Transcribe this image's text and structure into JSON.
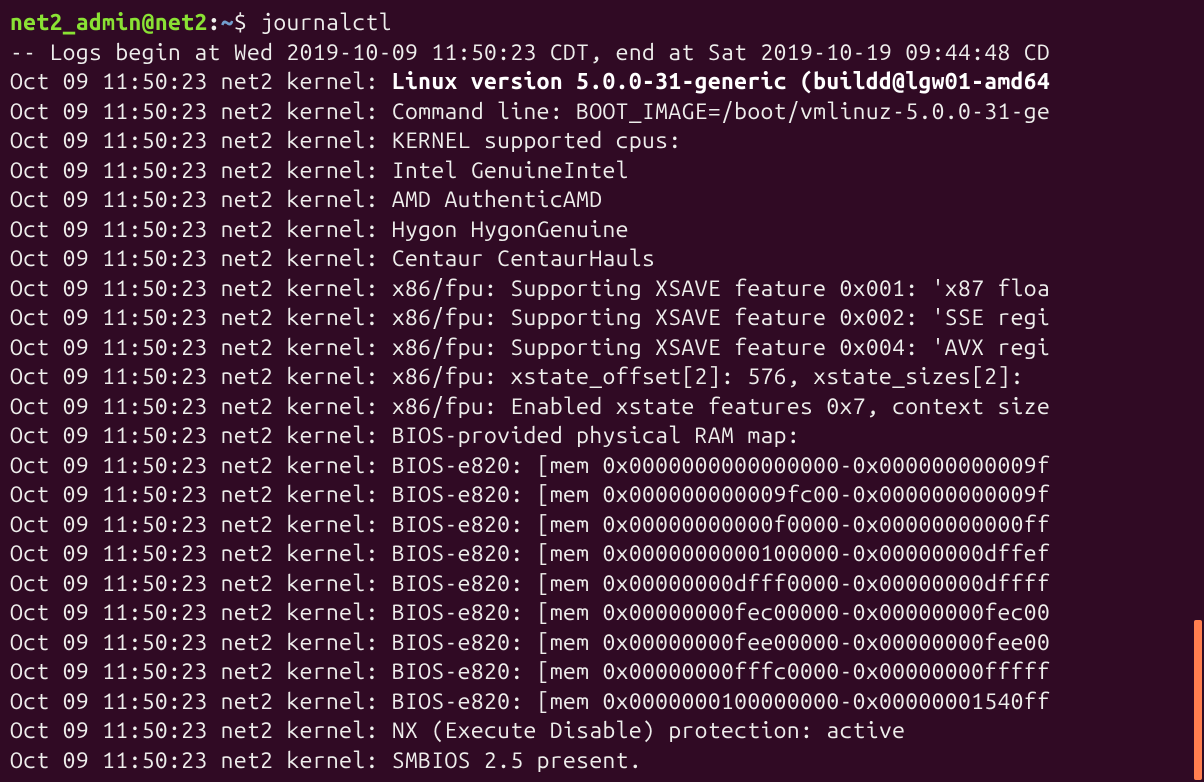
{
  "prompt": {
    "user": "net2_admin",
    "at": "@",
    "host": "net2",
    "colon": ":",
    "path": "~",
    "symbol": "$ ",
    "command": "journalctl"
  },
  "header": "-- Logs begin at Wed 2019-10-09 11:50:23 CDT, end at Sat 2019-10-19 09:44:48 CD",
  "log_prefix": "Oct 09 11:50:23 net2 kernel: ",
  "first_line": "Linux version 5.0.0-31-generic (buildd@lgw01-amd64",
  "lines": [
    "Command line: BOOT_IMAGE=/boot/vmlinuz-5.0.0-31-ge",
    "KERNEL supported cpus:",
    "  Intel GenuineIntel",
    "  AMD AuthenticAMD",
    "  Hygon HygonGenuine",
    "  Centaur CentaurHauls",
    "x86/fpu: Supporting XSAVE feature 0x001: 'x87 floa",
    "x86/fpu: Supporting XSAVE feature 0x002: 'SSE regi",
    "x86/fpu: Supporting XSAVE feature 0x004: 'AVX regi",
    "x86/fpu: xstate_offset[2]:  576, xstate_sizes[2]:",
    "x86/fpu: Enabled xstate features 0x7, context size",
    "BIOS-provided physical RAM map:",
    "BIOS-e820: [mem 0x0000000000000000-0x000000000009f",
    "BIOS-e820: [mem 0x000000000009fc00-0x000000000009f",
    "BIOS-e820: [mem 0x00000000000f0000-0x00000000000ff",
    "BIOS-e820: [mem 0x0000000000100000-0x00000000dffef",
    "BIOS-e820: [mem 0x00000000dfff0000-0x00000000dffff",
    "BIOS-e820: [mem 0x00000000fec00000-0x00000000fec00",
    "BIOS-e820: [mem 0x00000000fee00000-0x00000000fee00",
    "BIOS-e820: [mem 0x00000000fffc0000-0x00000000fffff",
    "BIOS-e820: [mem 0x0000000100000000-0x00000001540ff",
    "NX (Execute Disable) protection: active",
    "SMBIOS 2.5 present."
  ]
}
